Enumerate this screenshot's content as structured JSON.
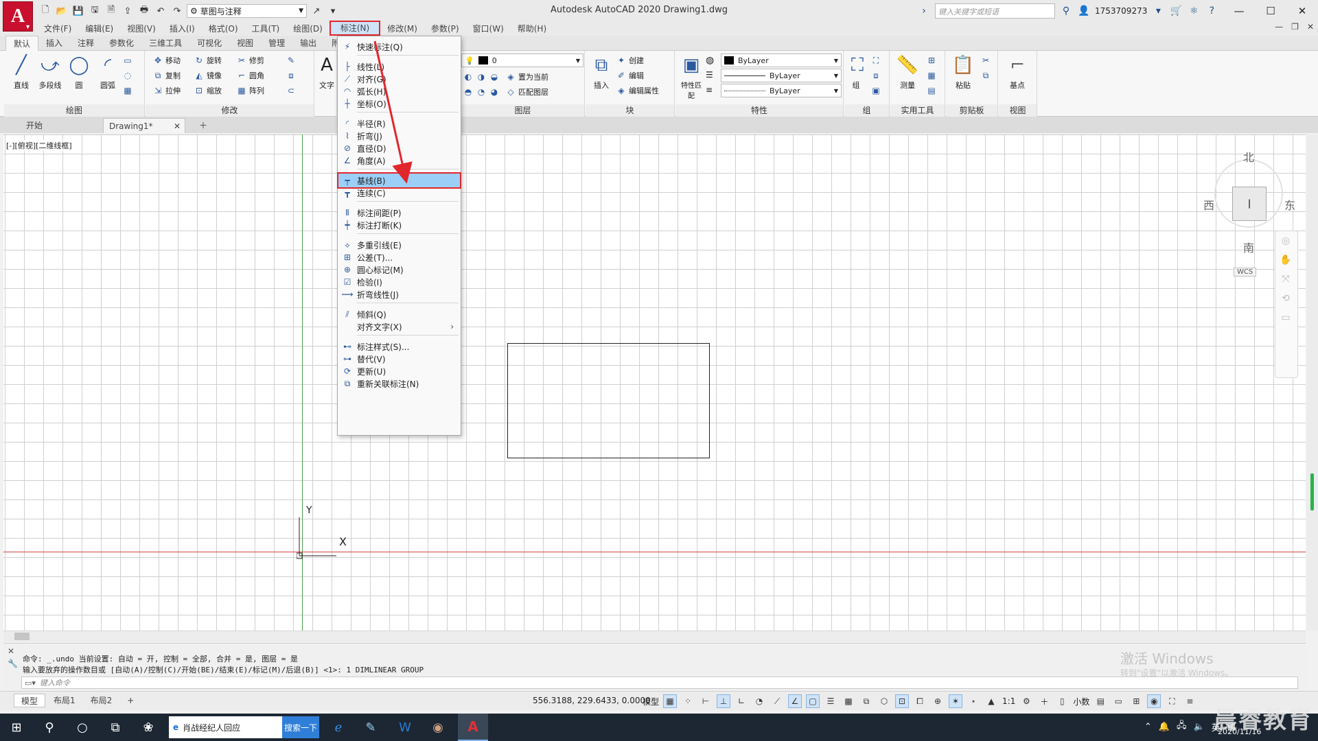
{
  "titlebar": {
    "app_logo": "A",
    "workspace": "草图与注释",
    "title": "Autodesk AutoCAD 2020    Drawing1.dwg",
    "search_placeholder": "键入关键字或短语",
    "user": "1753709273"
  },
  "menubar": {
    "items": [
      "文件(F)",
      "编辑(E)",
      "视图(V)",
      "插入(I)",
      "格式(O)",
      "工具(T)",
      "绘图(D)",
      "标注(N)",
      "修改(M)",
      "参数(P)",
      "窗口(W)",
      "帮助(H)"
    ],
    "active_index": 7
  },
  "ribbon_tabs": [
    "默认",
    "插入",
    "注释",
    "参数化",
    "三维工具",
    "可视化",
    "视图",
    "管理",
    "输出",
    "附加"
  ],
  "ribbon": {
    "draw": {
      "title": "绘图",
      "tools": [
        "直线",
        "多段线",
        "圆",
        "圆弧"
      ]
    },
    "modify": {
      "title": "修改",
      "tools": [
        "移动",
        "旋转",
        "修剪",
        "复制",
        "镜像",
        "圆角",
        "拉伸",
        "缩放",
        "阵列"
      ]
    },
    "text": {
      "label": "文字"
    },
    "layer": {
      "title": "图层",
      "current": "0",
      "tools": [
        "置为当前",
        "匹配图层"
      ]
    },
    "block": {
      "title": "块",
      "tools": [
        "插入",
        "创建",
        "编辑",
        "编辑属性"
      ]
    },
    "properties": {
      "title": "特性",
      "match": "特性匹配",
      "color": "ByLayer",
      "linetype": "ByLayer",
      "lineweight": "ByLayer"
    },
    "group": {
      "title": "组",
      "label": "组"
    },
    "utilities": {
      "title": "实用工具",
      "label": "测量"
    },
    "clipboard": {
      "title": "剪贴板",
      "label": "粘贴"
    },
    "view": {
      "title": "视图",
      "label": "基点"
    }
  },
  "file_tabs": {
    "start": "开始",
    "current": "Drawing1*"
  },
  "viewport": {
    "label": "[-][俯视][二维线框]",
    "ucs_y": "Y",
    "ucs_x": "X",
    "viewcube": {
      "north": "北",
      "south": "南",
      "east": "东",
      "west": "西",
      "wcs": "WCS"
    }
  },
  "dropdown": {
    "items": [
      {
        "label": "快速标注(Q)",
        "icon": "quick-dim-icon"
      },
      {
        "label": "线性(L)",
        "icon": "linear-dim-icon"
      },
      {
        "label": "对齐(G)",
        "icon": "aligned-dim-icon"
      },
      {
        "label": "弧长(H)",
        "icon": "arc-length-icon"
      },
      {
        "label": "坐标(O)",
        "icon": "ordinate-icon"
      },
      {
        "label": "半径(R)",
        "icon": "radius-icon"
      },
      {
        "label": "折弯(J)",
        "icon": "jogged-icon"
      },
      {
        "label": "直径(D)",
        "icon": "diameter-icon"
      },
      {
        "label": "角度(A)",
        "icon": "angle-icon"
      },
      {
        "label": "基线(B)",
        "icon": "baseline-icon"
      },
      {
        "label": "连续(C)",
        "icon": "continue-icon"
      },
      {
        "label": "标注间距(P)",
        "icon": "dim-space-icon"
      },
      {
        "label": "标注打断(K)",
        "icon": "dim-break-icon"
      },
      {
        "label": "多重引线(E)",
        "icon": "multileader-icon"
      },
      {
        "label": "公差(T)...",
        "icon": "tolerance-icon"
      },
      {
        "label": "圆心标记(M)",
        "icon": "center-mark-icon"
      },
      {
        "label": "检验(I)",
        "icon": "inspect-icon"
      },
      {
        "label": "折弯线性(J)",
        "icon": "jogged-linear-icon"
      },
      {
        "label": "倾斜(Q)",
        "icon": "oblique-icon"
      },
      {
        "label": "对齐文字(X)",
        "icon": "align-text-icon"
      },
      {
        "label": "标注样式(S)...",
        "icon": "dim-style-icon"
      },
      {
        "label": "替代(V)",
        "icon": "override-icon"
      },
      {
        "label": "更新(U)",
        "icon": "update-icon"
      },
      {
        "label": "重新关联标注(N)",
        "icon": "reassociate-icon"
      }
    ],
    "highlighted_index": 9
  },
  "command": {
    "line1": "命令:  _.undo 当前设置: 自动 = 开, 控制 = 全部, 合并 = 是, 图层 = 是",
    "line2": "输入要放弃的操作数目或 [自动(A)/控制(C)/开始(BE)/结束(E)/标记(M)/后退(B)] <1>: 1 DIMLINEAR GROUP",
    "placeholder": "键入命令"
  },
  "watermark": {
    "title": "激活 Windows",
    "sub": "转到\"设置\"以激活 Windows。"
  },
  "statusbar": {
    "layouts": [
      "模型",
      "布局1",
      "布局2"
    ],
    "coords": "556.3188, 229.6433, 0.0000",
    "model": "模型",
    "scale": "1:1",
    "units": "小数"
  },
  "taskbar": {
    "search_text": "肖战经纪人回应",
    "search_button": "搜索一下",
    "ime": "英",
    "date": "2020/11/16",
    "brand": "晨睿教育"
  }
}
